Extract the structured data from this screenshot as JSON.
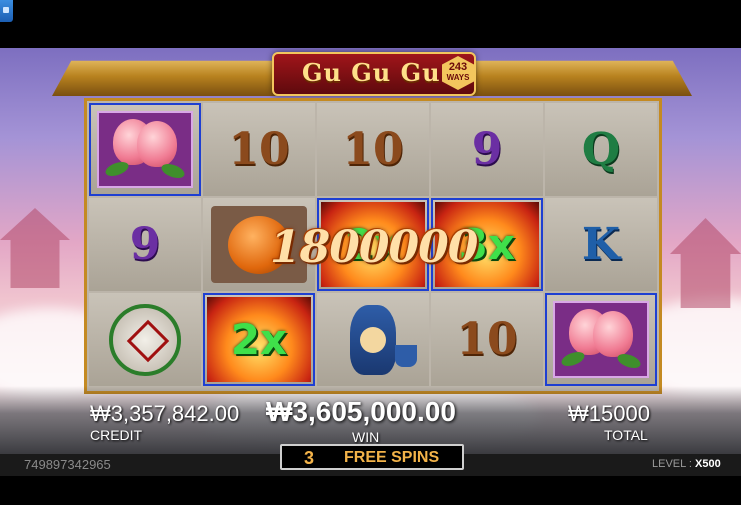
{
  "game": {
    "logo_text": "Gu Gu Gu 3",
    "ways_count": "243",
    "ways_label": "WAYS"
  },
  "reels": {
    "row1": [
      "peach",
      "10",
      "10",
      "9",
      "Q"
    ],
    "row2": [
      "9",
      "orange",
      "2x",
      "3x",
      "K"
    ],
    "row3": [
      "coin",
      "2x",
      "vase",
      "10",
      "peach"
    ],
    "winning_amount": "1800000"
  },
  "stats": {
    "credit_value": "₩3,357,842.00",
    "credit_label": "CREDIT",
    "win_value": "₩3,605,000.00",
    "win_label": "WIN",
    "total_value": "₩15000",
    "total_label": "TOTAL"
  },
  "free_spins": {
    "count": "3",
    "label": "FREE SPINS"
  },
  "status": {
    "session_id": "749897342965",
    "level_label": "LEVEL :",
    "level_value": "X500"
  }
}
